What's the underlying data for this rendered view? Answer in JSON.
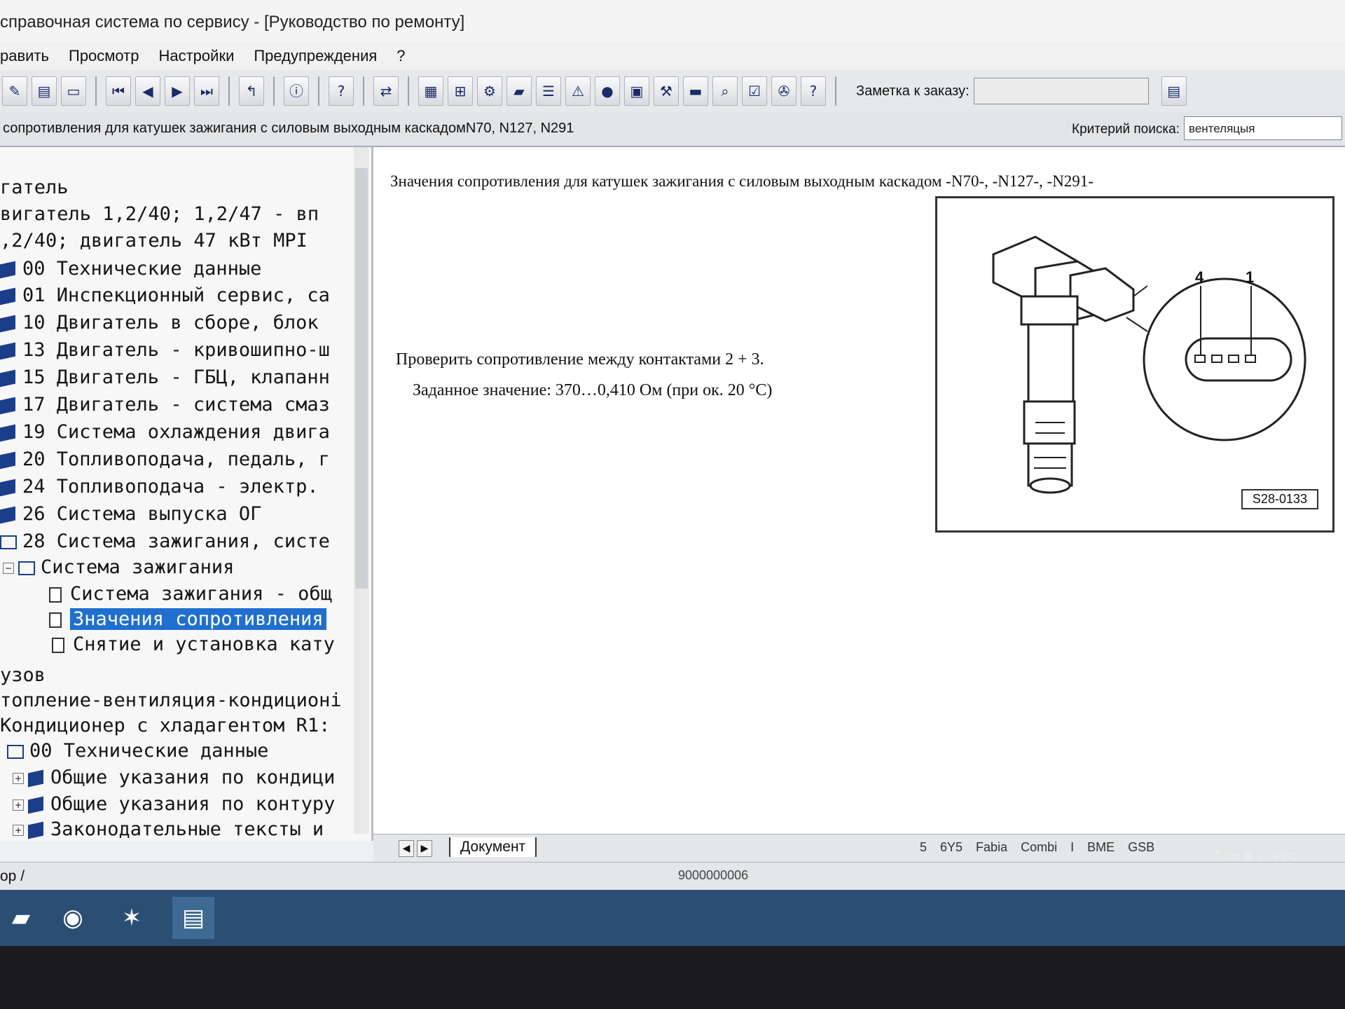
{
  "window": {
    "title": "справочная система по сервису - [Руководство по ремонту]"
  },
  "menu": [
    "равить",
    "Просмотр",
    "Настройки",
    "Предупреждения",
    "?"
  ],
  "toolbar": {
    "note_label": "Заметка к заказу:",
    "note_value": ""
  },
  "address": {
    "path": "сопротивления для катушек зажигания с силовым выходным каскадомN70, N127, N291",
    "search_label": "Критерий поиска:",
    "search_value": "вентеляцыя"
  },
  "tree": {
    "items": [
      {
        "label": "гатель"
      },
      {
        "label": "вигатель 1,2/40; 1,2/47 - вп"
      },
      {
        "label": ",2/40; двигатель 47 кВт MPI"
      },
      {
        "label": "00 Технические данные"
      },
      {
        "label": "01 Инспекционный сервис, са"
      },
      {
        "label": "10 Двигатель в сборе, блок"
      },
      {
        "label": "13 Двигатель - кривошипно-ш"
      },
      {
        "label": "15 Двигатель - ГБЦ, клапанн"
      },
      {
        "label": "17 Двигатель - система смаз"
      },
      {
        "label": "19 Система охлаждения двига"
      },
      {
        "label": "20 Топливоподача, педаль, г"
      },
      {
        "label": "24 Топливоподача - электр."
      },
      {
        "label": "26 Система выпуска ОГ"
      },
      {
        "label": "28 Система зажигания, систе"
      },
      {
        "label": "Система зажигания"
      },
      {
        "label": "Система зажигания - общ"
      },
      {
        "label": "Значения сопротивления"
      },
      {
        "label": "Снятие и установка кату"
      },
      {
        "label": "узов"
      },
      {
        "label": "топление-вентиляция-кондиционі"
      },
      {
        "label": "Кондиционер с хладагентом R1:"
      },
      {
        "label": "00 Технические данные"
      },
      {
        "label": "Общие указания по кондици"
      },
      {
        "label": "Общие указания по контуру"
      },
      {
        "label": "Законодательные тексты и"
      }
    ]
  },
  "document": {
    "title": "Значения сопротивления для катушек зажигания с силовым выходным каскадом -N70-, -N127-, -N291-",
    "instruction": "Проверить сопротивление между контактами 2 + 3.",
    "spec": "Заданное значение: 370…0,410 Ом (при ок. 20 °С)",
    "figure": {
      "code": "S28-0133",
      "pin_left": "4",
      "pin_right": "1"
    }
  },
  "tabs": {
    "active": "Документ",
    "meta": "5 6Y5 Fabia Combi I BME GSB"
  },
  "status": {
    "left": "ор /",
    "number": "9000000006"
  },
  "tray": {
    "lang": "РУС"
  }
}
